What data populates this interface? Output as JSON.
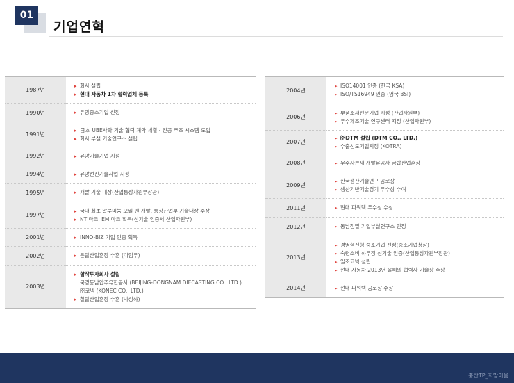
{
  "header": {
    "number": "01",
    "title": "기업연혁"
  },
  "left": [
    {
      "year": "1987년",
      "items": [
        {
          "text": "회사 설립"
        },
        {
          "text": "현대 자동차 1차 협력업체 등록",
          "bold": true
        }
      ]
    },
    {
      "year": "1990년",
      "items": [
        {
          "text": "유망중소기업 선정"
        }
      ]
    },
    {
      "year": "1991년",
      "items": [
        {
          "text": "日本 UBE사와 기술 협력 계약 체결 - 진공 주조 시스템 도입"
        },
        {
          "text": "회사 부설 기술연구소 설립"
        }
      ]
    },
    {
      "year": "1992년",
      "items": [
        {
          "text": "유망기술기업 지정"
        }
      ]
    },
    {
      "year": "1994년",
      "items": [
        {
          "text": "유망선진기술사업 지정"
        }
      ]
    },
    {
      "year": "1995년",
      "items": [
        {
          "text": "개발 기술 대상(산업통상자원부장관)"
        }
      ]
    },
    {
      "year": "1997년",
      "items": [
        {
          "text": "국내 최초 알루미늄 오일 팬 개발, 통상산업부 기술대상 수상"
        },
        {
          "text": "NT 마크, EM 마크 획득(신기술 인증서,산업자원부)"
        }
      ]
    },
    {
      "year": "2001년",
      "items": [
        {
          "text": "INNO-BIZ 기업 인증 획득"
        }
      ]
    },
    {
      "year": "2002년",
      "items": [
        {
          "text": "은탑산업훈장 수훈 (이임우)"
        }
      ]
    },
    {
      "year": "2003년",
      "items": [
        {
          "text": "합작투자회사 설립",
          "bold": true
        },
        {
          "text": "북경동남압주유한공사 (BEIJING-DONGNAM DIECASTING CO., LTD.)",
          "sub": true
        },
        {
          "text": "㈜코넥 (KONEC CO., LTD.)",
          "sub": true
        },
        {
          "text": "철탑산업훈장 수훈 (박성하)"
        }
      ]
    }
  ],
  "right": [
    {
      "year": "2004년",
      "items": [
        {
          "text": "ISO14001 인증 (한국 KSA)"
        },
        {
          "text": "ISO/TS16949 인증 (영국 BSI)"
        }
      ]
    },
    {
      "year": "2006년",
      "items": [
        {
          "text": "부품소재전문기업 지정 (산업자원부)"
        },
        {
          "text": "우수제조기술 연구센터 지정 (산업자원부)"
        }
      ]
    },
    {
      "year": "2007년",
      "items": [
        {
          "text": "㈜DTM 설립 (DTM CO., LTD.)",
          "bold": true
        },
        {
          "text": "수출선도기업지정 (KOTRA)"
        }
      ]
    },
    {
      "year": "2008년",
      "items": [
        {
          "text": "우수자본재 개발유공자 금탑산업훈장"
        }
      ]
    },
    {
      "year": "2009년",
      "items": [
        {
          "text": "한국생산기술연구 공로상"
        },
        {
          "text": "생산기반기술경기 우수상 수여"
        }
      ]
    },
    {
      "year": "2011년",
      "items": [
        {
          "text": "현대 파워텍 우수상 수상"
        }
      ]
    },
    {
      "year": "2012년",
      "items": [
        {
          "text": "동남정밀 기업부설연구소 인정"
        }
      ]
    },
    {
      "year": "2013년",
      "items": [
        {
          "text": "경영혁신형 중소기업 선정(중소기업청장)"
        },
        {
          "text": "숙련소비 하우징 신기술 인증(산업통상자원부장관)"
        },
        {
          "text": "일조코넥 설립"
        },
        {
          "text": "현대 자동차 2013년 올해의 협력사 기술상 수상"
        }
      ]
    },
    {
      "year": "2014년",
      "items": [
        {
          "text": "현대 파워텍 공로상 수상"
        }
      ]
    }
  ],
  "footer": {
    "text": "충산TP_희망이음"
  },
  "colors": {
    "navy": "#1f3560",
    "bullet": "#e0403a",
    "year_bg": "#e9e9e9"
  }
}
